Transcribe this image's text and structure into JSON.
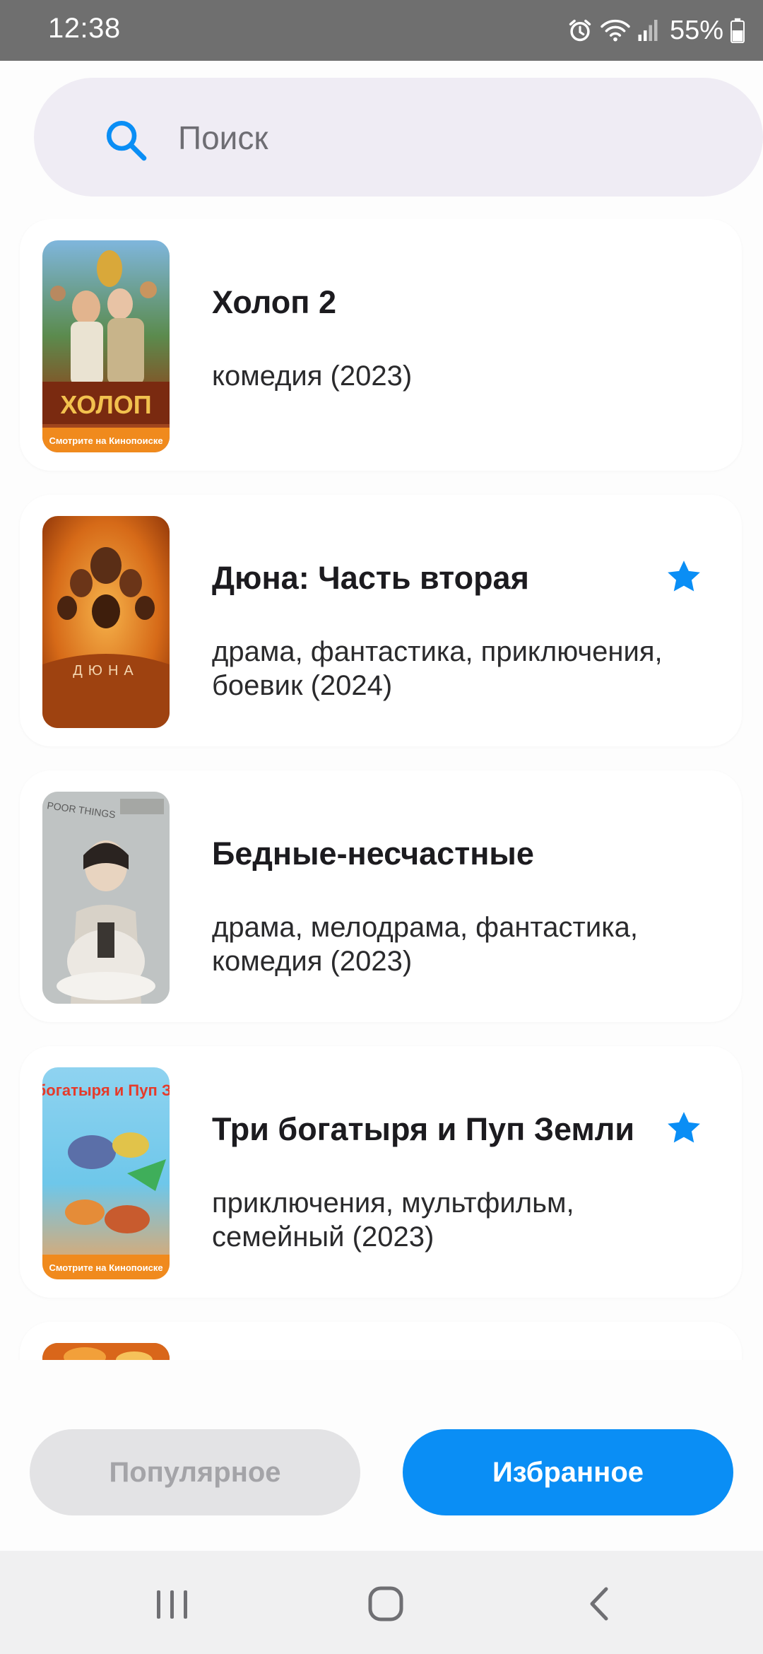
{
  "status_bar": {
    "time": "12:38",
    "battery": "55%",
    "icons": [
      "alarm-icon",
      "wifi-icon",
      "signal-icon",
      "battery-icon"
    ]
  },
  "search": {
    "placeholder": "Поиск",
    "value": ""
  },
  "movies": [
    {
      "title": "Холоп 2",
      "genres": "комедия (2023)",
      "favorite": false,
      "poster_text": "ХОЛОП",
      "poster_footer": "Смотрите на Кинопоиске"
    },
    {
      "title": "Дюна: Часть вторая",
      "genres": "драма, фантастика, приключения, боевик (2024)",
      "favorite": true,
      "poster_text": "ДЮНА"
    },
    {
      "title": "Бедные-несчастные",
      "genres": "драма, мелодрама, фантастика, комедия (2023)",
      "favorite": false,
      "poster_text": "POOR THINGS"
    },
    {
      "title": "Три богатыря и Пуп Земли",
      "genres": "приключения, мультфильм, семейный (2023)",
      "favorite": true,
      "poster_text": "ТРИ богатыря и Пуп Земли",
      "poster_footer": "Смотрите на Кинопоиске"
    }
  ],
  "bottom_buttons": {
    "popular": "Популярное",
    "favorites": "Избранное"
  },
  "colors": {
    "accent": "#0a8ef5",
    "search_bg": "#efecf4",
    "inactive_button_bg": "#e3e3e5",
    "inactive_button_text": "#a4a4a8",
    "status_bar_bg": "#6f6f6f"
  },
  "nav_bar": {
    "icons": [
      "recent-apps-icon",
      "home-icon",
      "back-icon"
    ]
  }
}
